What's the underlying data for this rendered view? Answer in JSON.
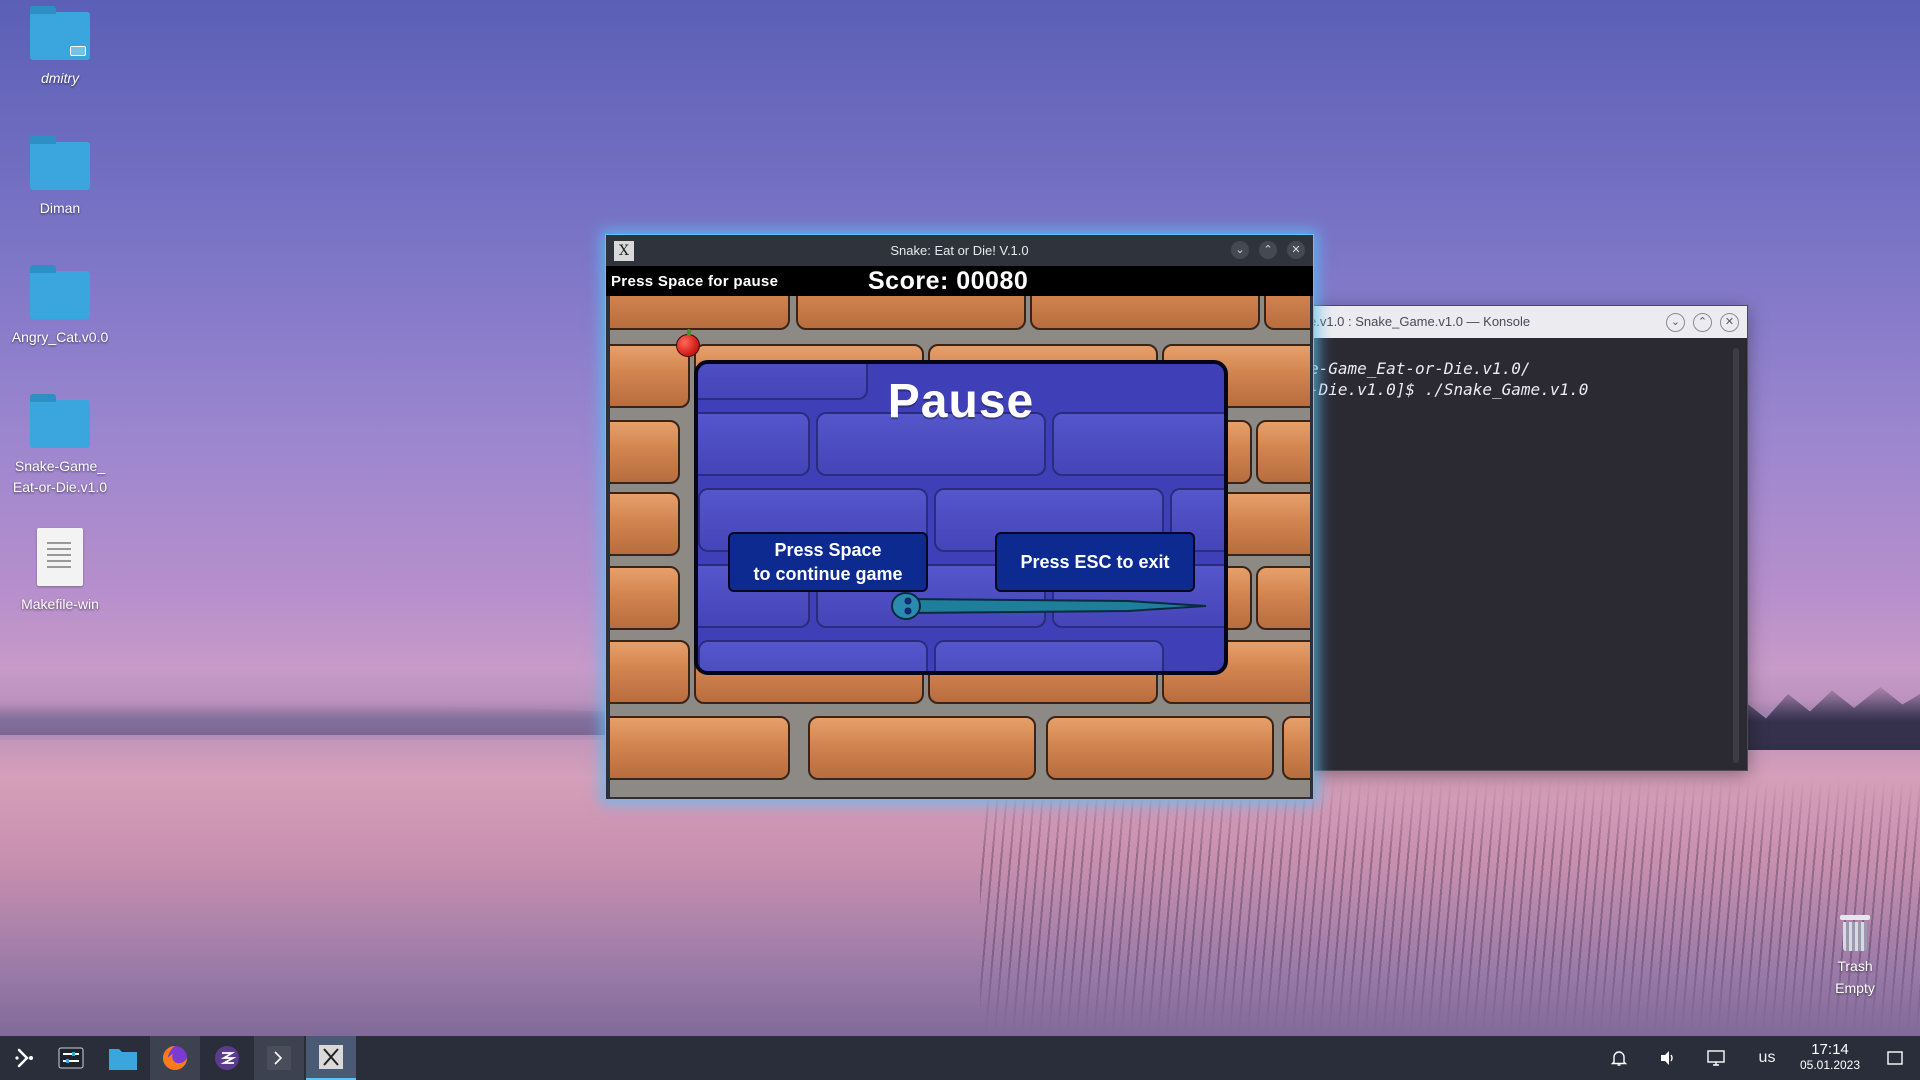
{
  "desktop": {
    "icons": [
      {
        "label": "dmitry"
      },
      {
        "label": "Diman"
      },
      {
        "label": "Angry_Cat.v0.0"
      },
      {
        "label": "Snake-Game_\nEat-or-Die.v1.0",
        "line1": "Snake-Game_",
        "line2": "Eat-or-Die.v1.0"
      },
      {
        "label": "Makefile-win"
      }
    ],
    "trash": {
      "label": "Trash",
      "status": "Empty"
    }
  },
  "konsole": {
    "title": "e.v1.0 : Snake_Game.v1.0 — Konsole",
    "lines": [
      "e-Game_Eat-or-Die.v1.0/",
      "-Die.v1.0]$ ./Snake_Game.v1.0"
    ]
  },
  "game_window": {
    "title": "Snake: Eat or Die! V.1.0",
    "hud": {
      "hint": "Press Space for pause",
      "score": "Score: 00080"
    },
    "pause": {
      "title": "Pause",
      "continue_line1": "Press Space",
      "continue_line2": "to continue game",
      "exit_label": "Press ESC to exit"
    }
  },
  "taskbar": {
    "keyboard_layout": "us",
    "time": "17:14",
    "date": "05.01.2023"
  },
  "icons": {
    "launcher": "kde-launcher-icon",
    "settings": "settings-sliders-icon",
    "files": "folder-icon",
    "browser": "firefox-icon",
    "emacs": "emacs-icon",
    "terminal": "terminal-icon",
    "x11": "x-app-icon",
    "notifications": "bell-icon",
    "volume": "speaker-icon",
    "network": "network-icon",
    "desktop": "show-desktop-icon"
  },
  "colors": {
    "accent": "#5ec4f5",
    "pause_panel": "#3f3fb8",
    "pause_button": "#0c2a90",
    "hud_bg": "#000000",
    "taskbar_bg": "#2a2e3a"
  }
}
